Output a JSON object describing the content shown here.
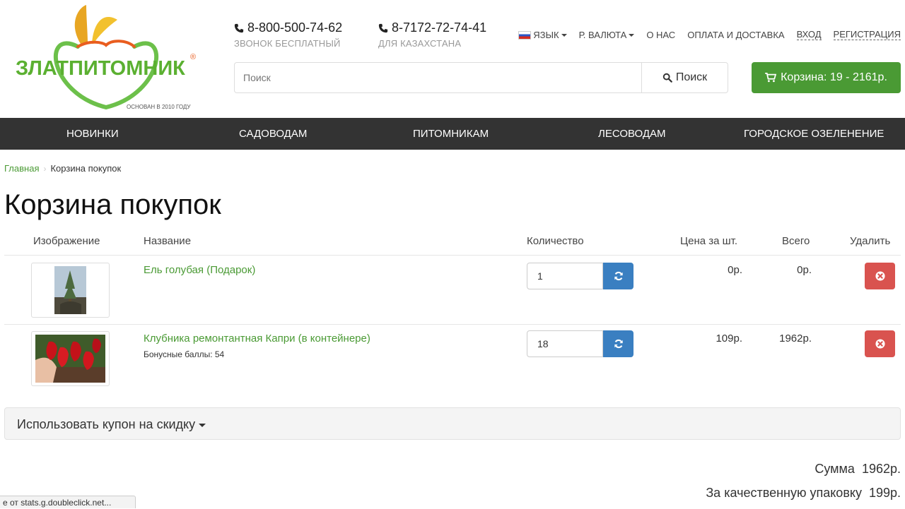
{
  "header": {
    "brand": "ЗЛАТПИТОМНИК",
    "registered": "®",
    "tagline": "ОСНОВАН В 2010 ГОДУ",
    "phone1": {
      "number": "8-800-500-74-62",
      "note": "ЗВОНОК БЕСПЛАТНЫЙ"
    },
    "phone2": {
      "number": "8-7172-72-74-41",
      "note": "ДЛЯ КАЗАХСТАНА"
    },
    "topnav": {
      "language": "ЯЗЫК",
      "currency": "Р. ВАЛЮТА",
      "about": "О НАС",
      "payment": "ОПЛАТА И ДОСТАВКА",
      "login": "ВХОД",
      "register": "РЕГИСТРАЦИЯ"
    },
    "search": {
      "placeholder": "Поиск",
      "button": "Поиск"
    },
    "cart": "Корзина: 19 - 2161р."
  },
  "menu": [
    "НОВИНКИ",
    "САДОВОДАМ",
    "ПИТОМНИКАМ",
    "ЛЕСОВОДАМ",
    "ГОРОДСКОЕ ОЗЕЛЕНЕНИЕ"
  ],
  "breadcrumb": {
    "home": "Главная",
    "current": "Корзина покупок"
  },
  "page_title": "Корзина покупок",
  "table": {
    "headers": {
      "image": "Изображение",
      "name": "Название",
      "quantity": "Количество",
      "unit_price": "Цена за шт.",
      "total": "Всего",
      "remove": "Удалить"
    },
    "rows": [
      {
        "name": "Ель голубая (Подарок)",
        "bonus": "",
        "quantity": "1",
        "unit_price": "0р.",
        "total": "0р."
      },
      {
        "name": "Клубника ремонтантная Капри (в контейнере)",
        "bonus": "Бонусные баллы: 54",
        "quantity": "18",
        "unit_price": "109р.",
        "total": "1962р."
      }
    ]
  },
  "coupon": "Использовать купон на скидку",
  "totals": {
    "subtotal_label": "Сумма",
    "subtotal_value": "1962р.",
    "packing_label": "За качественную упаковку",
    "packing_value": "199р."
  },
  "statusbar": "е от stats.g.doubleclick.net...",
  "colors": {
    "brand_green": "#4a9a34",
    "menu_bg": "#333333",
    "refresh_blue": "#3a7fc1",
    "delete_red": "#d9534f"
  }
}
